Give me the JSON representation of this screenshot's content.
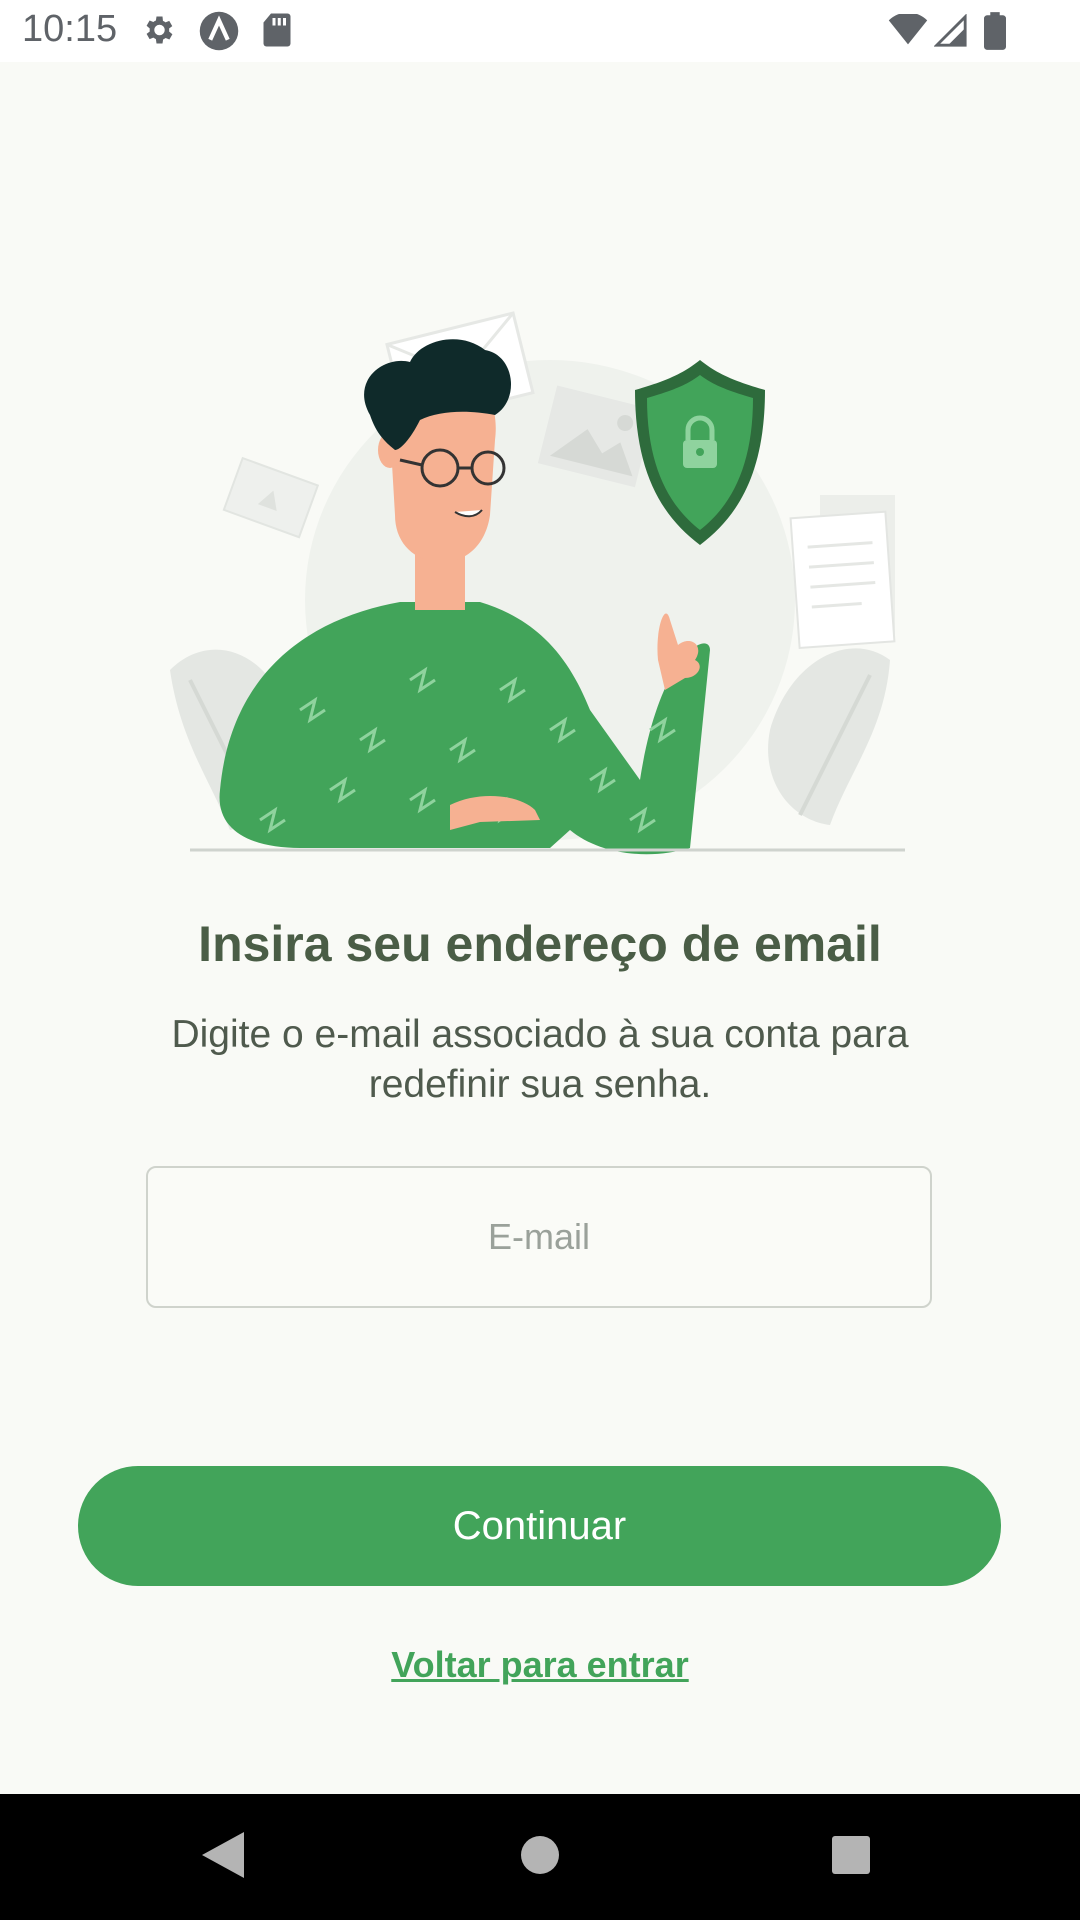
{
  "status_bar": {
    "time": "10:15",
    "left_icons": [
      "gear-icon",
      "a-circle-icon",
      "sd-card-icon"
    ],
    "right_icons": [
      "wifi-icon",
      "signal-icon",
      "battery-icon"
    ]
  },
  "illustration": {
    "name": "person-with-security-shield-illustration",
    "colors": {
      "accent": "#42a45a",
      "shield_dark": "#2e6b3c",
      "hair": "#0f2a2a",
      "skin": "#f6b192"
    }
  },
  "screen": {
    "title": "Insira seu endereço de email",
    "subtitle": "Digite o e-mail associado à sua conta para redefinir sua senha.",
    "email_field": {
      "value": "",
      "placeholder": "E-mail"
    },
    "continue_label": "Continuar",
    "back_link_label": "Voltar para entrar"
  },
  "nav_bar": {
    "icons": [
      "back-icon",
      "home-icon",
      "recents-icon"
    ]
  },
  "colors": {
    "accent": "#42a45a",
    "background": "#f9faf6",
    "title": "#4a5d46"
  }
}
